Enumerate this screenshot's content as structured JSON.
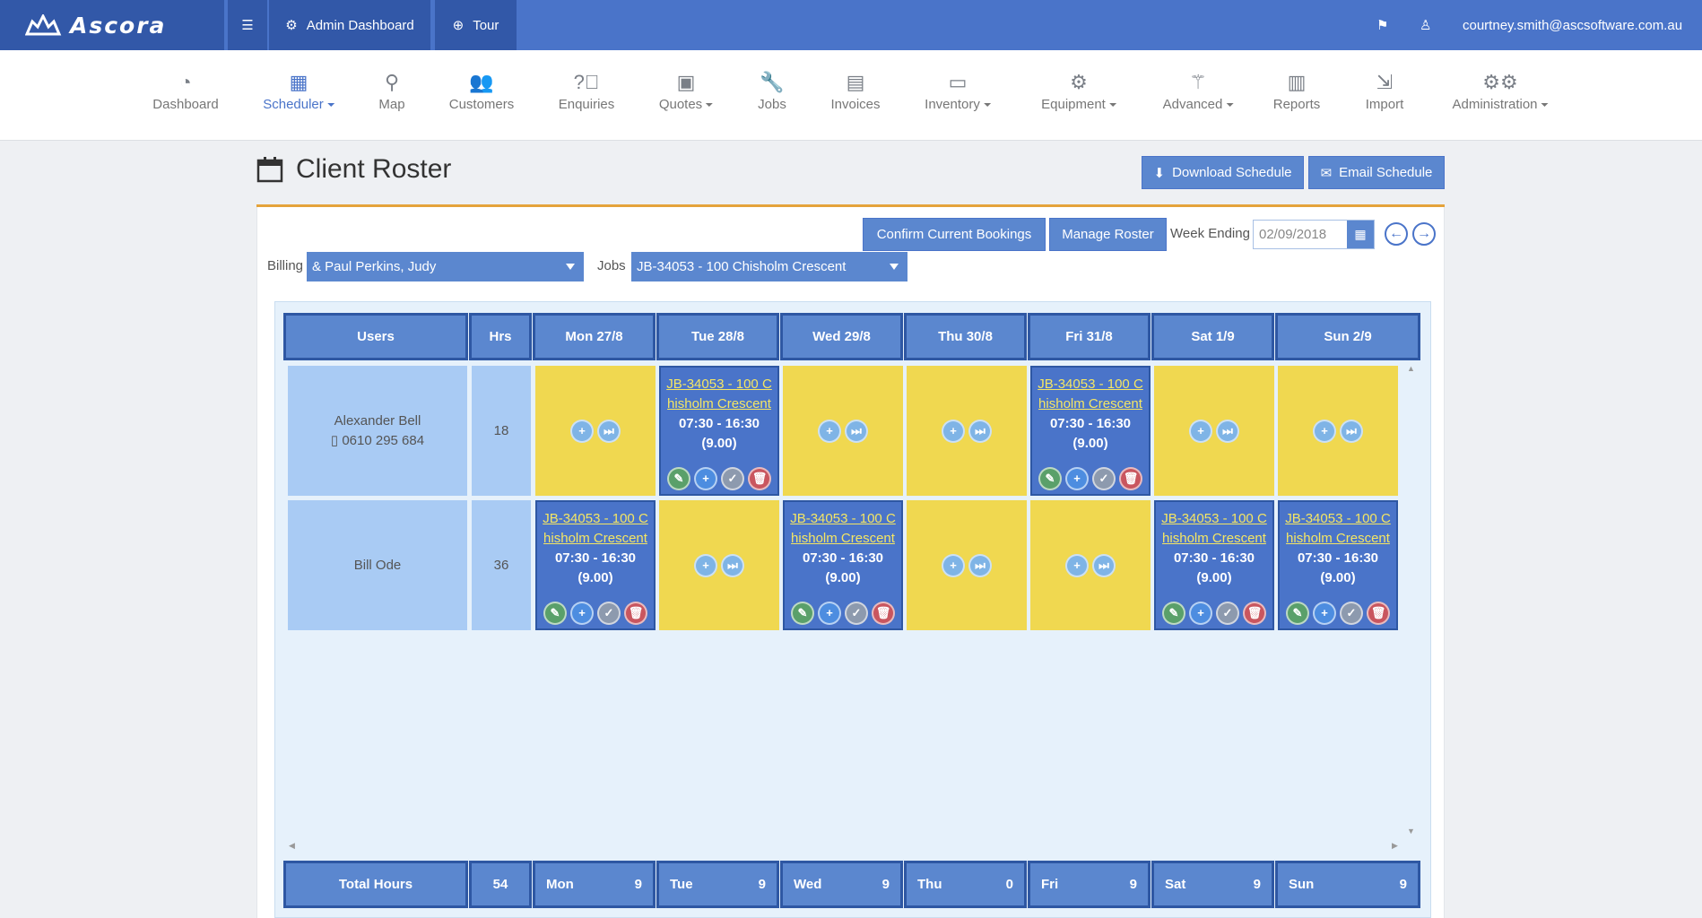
{
  "topbar": {
    "brand": "Ascora",
    "admin_dashboard": "Admin Dashboard",
    "tour": "Tour",
    "user_email": "courtney.smith@ascsoftware.com.au"
  },
  "nav": {
    "items": [
      {
        "label": "Dashboard",
        "icon": "dashboard-icon"
      },
      {
        "label": "Scheduler",
        "icon": "calendar-icon",
        "dropdown": true,
        "active": true
      },
      {
        "label": "Map",
        "icon": "map-marker-icon"
      },
      {
        "label": "Customers",
        "icon": "users-icon"
      },
      {
        "label": "Enquiries",
        "icon": "question-icon"
      },
      {
        "label": "Quotes",
        "icon": "briefcase-icon",
        "dropdown": true
      },
      {
        "label": "Jobs",
        "icon": "wrench-icon"
      },
      {
        "label": "Invoices",
        "icon": "book-icon"
      },
      {
        "label": "Inventory",
        "icon": "inbox-icon",
        "dropdown": true
      },
      {
        "label": "Equipment",
        "icon": "gear-icon",
        "dropdown": true
      },
      {
        "label": "Advanced",
        "icon": "magic-wand-icon",
        "dropdown": true
      },
      {
        "label": "Reports",
        "icon": "bar-chart-icon"
      },
      {
        "label": "Import",
        "icon": "import-icon"
      },
      {
        "label": "Administration",
        "icon": "gears-icon",
        "dropdown": true
      }
    ]
  },
  "page": {
    "title": "Client Roster",
    "download_schedule": "Download Schedule",
    "email_schedule": "Email Schedule"
  },
  "controls": {
    "confirm_bookings": "Confirm Current Bookings",
    "manage_roster": "Manage Roster",
    "week_ending_label": "Week Ending",
    "week_ending_value": "02/09/2018",
    "billing_label": "Billing",
    "billing_value": "& Paul Perkins, Judy",
    "jobs_label": "Jobs",
    "jobs_value": "JB-34053 - 100 Chisholm Crescent"
  },
  "roster": {
    "headers": {
      "users": "Users",
      "hrs": "Hrs",
      "days": [
        "Mon 27/8",
        "Tue 28/8",
        "Wed 29/8",
        "Thu 30/8",
        "Fri 31/8",
        "Sat 1/9",
        "Sun 2/9"
      ]
    },
    "rows": [
      {
        "name": "Alexander Bell",
        "phone": "0610 295 684",
        "hrs": "18",
        "cells": [
          {
            "booked": false
          },
          {
            "booked": true,
            "job_line1": "JB-34053 - 100 C",
            "job_line2": "hisholm Crescent",
            "time": "07:30 - 16:30",
            "hours": "(9.00)"
          },
          {
            "booked": false
          },
          {
            "booked": false
          },
          {
            "booked": true,
            "job_line1": "JB-34053 - 100 C",
            "job_line2": "hisholm Crescent",
            "time": "07:30 - 16:30",
            "hours": "(9.00)"
          },
          {
            "booked": false
          },
          {
            "booked": false
          }
        ]
      },
      {
        "name": "Bill Ode",
        "phone": "",
        "hrs": "36",
        "cells": [
          {
            "booked": true,
            "job_line1": "JB-34053 - 100 C",
            "job_line2": "hisholm Crescent",
            "time": "07:30 - 16:30",
            "hours": "(9.00)"
          },
          {
            "booked": false
          },
          {
            "booked": true,
            "job_line1": "JB-34053 - 100 C",
            "job_line2": "hisholm Crescent",
            "time": "07:30 - 16:30",
            "hours": "(9.00)"
          },
          {
            "booked": false
          },
          {
            "booked": false
          },
          {
            "booked": true,
            "job_line1": "JB-34053 - 100 C",
            "job_line2": "hisholm Crescent",
            "time": "07:30 - 16:30",
            "hours": "(9.00)"
          },
          {
            "booked": true,
            "job_line1": "JB-34053 - 100 C",
            "job_line2": "hisholm Crescent",
            "time": "07:30 - 16:30",
            "hours": "(9.00)"
          }
        ]
      }
    ],
    "footer": {
      "total_label": "Total Hours",
      "total_value": "54",
      "days": [
        {
          "day": "Mon",
          "value": "9"
        },
        {
          "day": "Tue",
          "value": "9"
        },
        {
          "day": "Wed",
          "value": "9"
        },
        {
          "day": "Thu",
          "value": "0"
        },
        {
          "day": "Fri",
          "value": "9"
        },
        {
          "day": "Sat",
          "value": "9"
        },
        {
          "day": "Sun",
          "value": "9"
        }
      ]
    }
  },
  "colors": {
    "topbar": "#4a74c9",
    "accent_orange": "#e4a33a",
    "empty_cell": "#f0d850",
    "user_cell": "#a9cbf4",
    "job_cell": "#4a74c9"
  }
}
